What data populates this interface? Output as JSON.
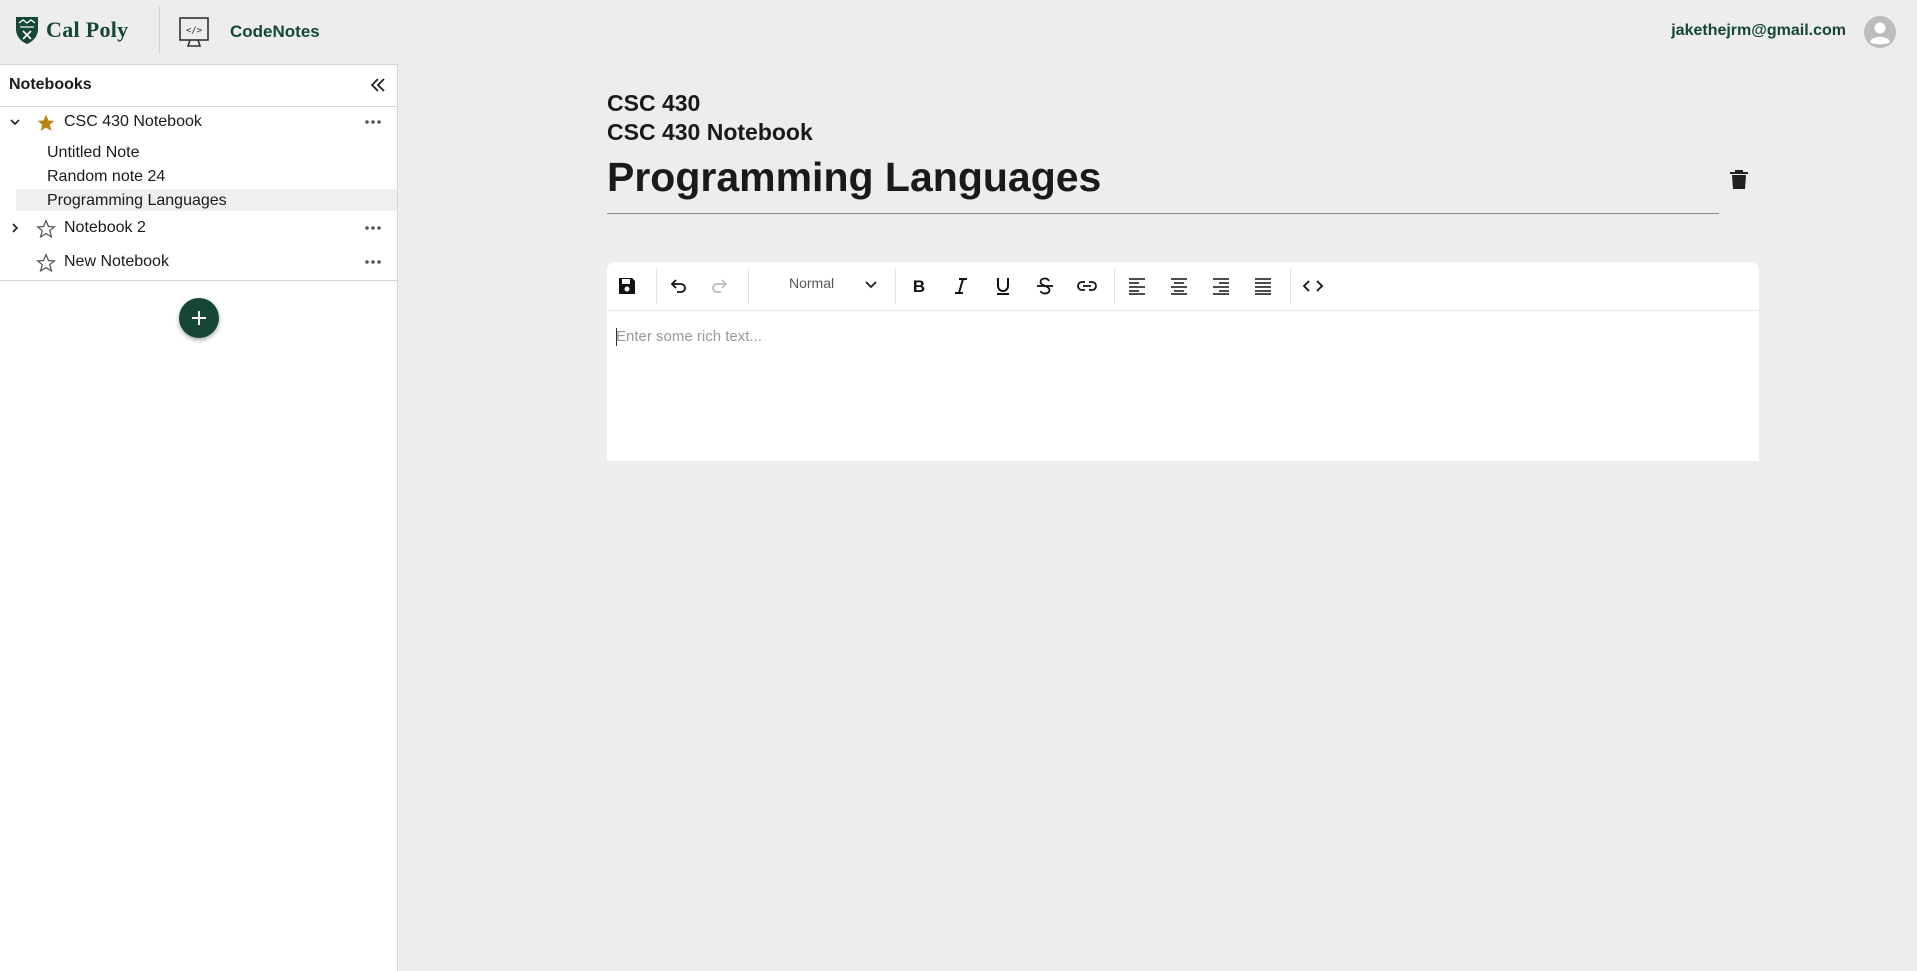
{
  "header": {
    "brand": "Cal Poly",
    "app_title": "CodeNotes",
    "user_email": "jakethejrm@gmail.com"
  },
  "sidebar": {
    "title": "Notebooks",
    "notebooks": [
      {
        "name": "CSC 430 Notebook",
        "starred": true,
        "expanded": true,
        "notes": [
          "Untitled Note",
          "Random note 24",
          "Programming Languages"
        ]
      },
      {
        "name": "Notebook 2",
        "starred": false,
        "expanded": false,
        "notes": []
      },
      {
        "name": "New Notebook",
        "starred": false,
        "expanded": false,
        "notes": []
      }
    ],
    "active_note": "Programming Languages"
  },
  "main": {
    "course": "CSC 430",
    "notebook": "CSC 430 Notebook",
    "note_title": "Programming Languages"
  },
  "editor": {
    "block_type": "Normal",
    "placeholder": "Enter some rich text..."
  },
  "colors": {
    "brand_green": "#154734",
    "star_gold": "#b8860b",
    "background": "#ededed"
  }
}
